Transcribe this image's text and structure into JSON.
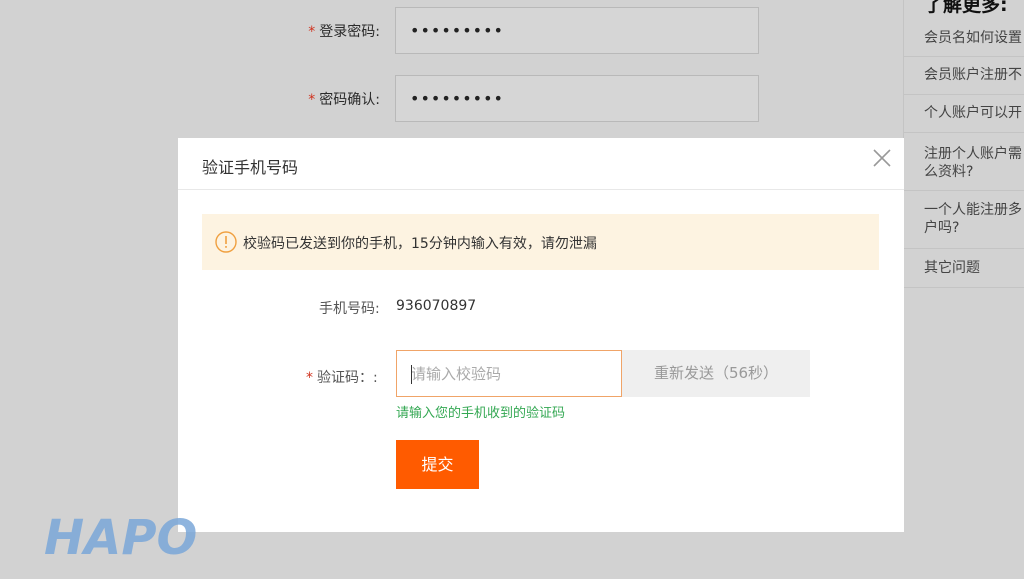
{
  "background_form": {
    "password_label": "登录密码:",
    "password_value": "•••••••••",
    "confirm_label": "密码确认:",
    "confirm_value": "•••••••••"
  },
  "side_panel": {
    "title": "了解更多:",
    "items": [
      "会员名如何设置",
      "会员账户注册不",
      "个人账户可以开",
      "注册个人账户需",
      "么资料?",
      "一个人能注册多",
      "户吗?",
      "其它问题"
    ]
  },
  "modal": {
    "title": "验证手机号码",
    "notice_text": "校验码已发送到你的手机，15分钟内输入有效，请勿泄漏",
    "phone_label": "手机号码:",
    "phone_value": "936070897",
    "code_label": "验证码：:",
    "code_placeholder": "请输入校验码",
    "resend_label": "重新发送（56秒）",
    "hint": "请输入您的手机收到的验证码",
    "submit_label": "提交"
  },
  "watermark": "HAPO",
  "colors": {
    "accent": "#ff5b00",
    "required": "#d0321e",
    "hint": "#34a853",
    "notice_bg": "#fdf3e1",
    "overlay_bg": "#d2d2d2"
  }
}
